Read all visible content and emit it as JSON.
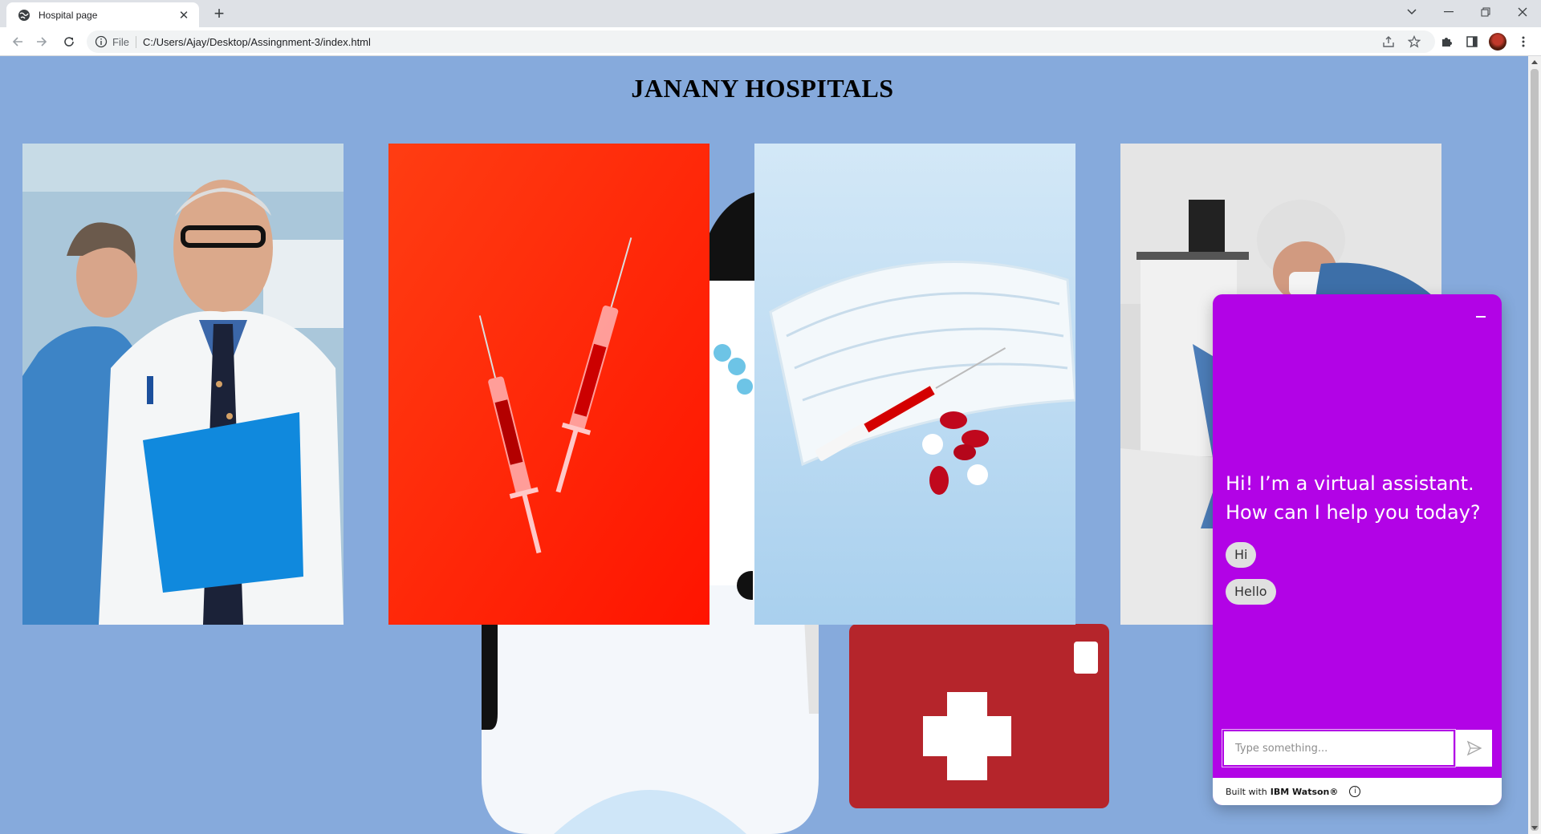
{
  "browser": {
    "tab_title": "Hospital page",
    "url_scheme_label": "File",
    "url": "C:/Users/Ajay/Desktop/Assingnment-3/index.html"
  },
  "page": {
    "title": "JANANY HOSPITALS",
    "background_color": "#86aadc",
    "photos": [
      {
        "subject": "doctor and nurse holding blue folder"
      },
      {
        "subject": "two syringes on red background"
      },
      {
        "subject": "syringe, face mask and red capsules"
      },
      {
        "subject": "healthcare worker in scrubs sitting"
      }
    ]
  },
  "chat": {
    "accent_color": "#b203e6",
    "greeting": "Hi! I’m a virtual assistant. How can I help you today?",
    "options": [
      "Hi",
      "Hello"
    ],
    "input_placeholder": "Type something...",
    "footer_prefix": "Built with",
    "footer_brand": "IBM Watson®",
    "info_glyph": "i"
  }
}
